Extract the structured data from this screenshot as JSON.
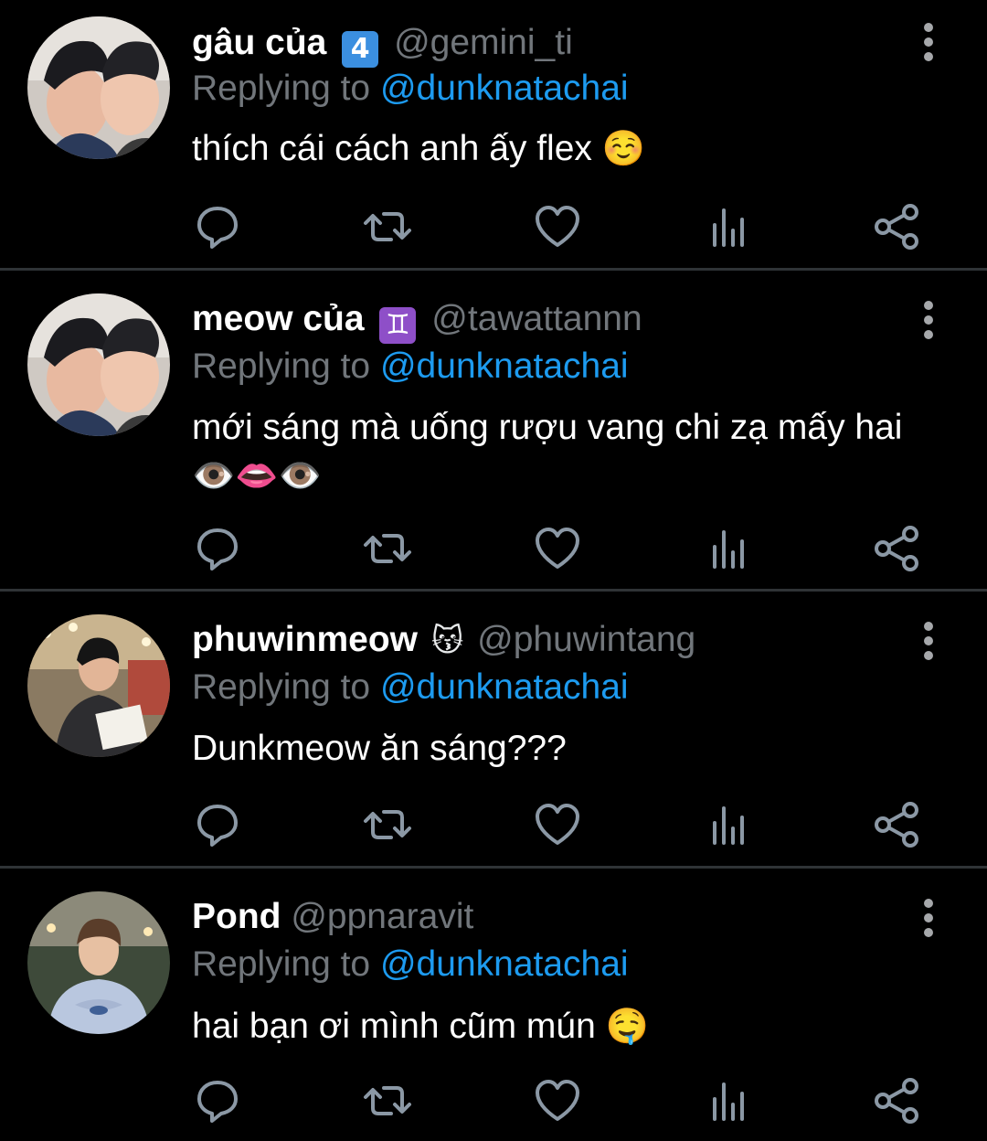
{
  "tweets": [
    {
      "display_name": "gâu của",
      "badge": "4",
      "handle": "@gemini_ti",
      "replying_prefix": "Replying to",
      "replying_to": "@dunknatachai",
      "text": "thích cái cách anh ấy flex",
      "emoji": "☺️"
    },
    {
      "display_name": "meow của",
      "badge": "♊",
      "handle": "@tawattannn",
      "replying_prefix": "Replying to",
      "replying_to": "@dunknatachai",
      "text": "mới sáng mà uống rượu vang chi zạ mấy hai",
      "emoji": "👁️👄👁️"
    },
    {
      "display_name": "phuwinmeow",
      "badge": "😽",
      "handle": "@phuwintang",
      "replying_prefix": "Replying to",
      "replying_to": "@dunknatachai",
      "text": "Dunkmeow ăn sáng???",
      "emoji": ""
    },
    {
      "display_name": "Pond",
      "badge": "",
      "handle": "@ppnaravit",
      "replying_prefix": "Replying to",
      "replying_to": "@dunknatachai",
      "text": "hai bạn ơi mình cũm mún",
      "emoji": "🤤"
    }
  ],
  "icons": {
    "reply": "reply-icon",
    "retweet": "retweet-icon",
    "like": "heart-icon",
    "analytics": "analytics-icon",
    "share": "share-icon",
    "more": "more-vertical-icon"
  },
  "colors": {
    "background": "#000000",
    "text": "#ffffff",
    "muted": "#71767b",
    "link": "#1d9bf0",
    "divider": "#2f3336",
    "badge_keycap": "#3b8fe0",
    "badge_gemini": "#8e4fc8"
  }
}
